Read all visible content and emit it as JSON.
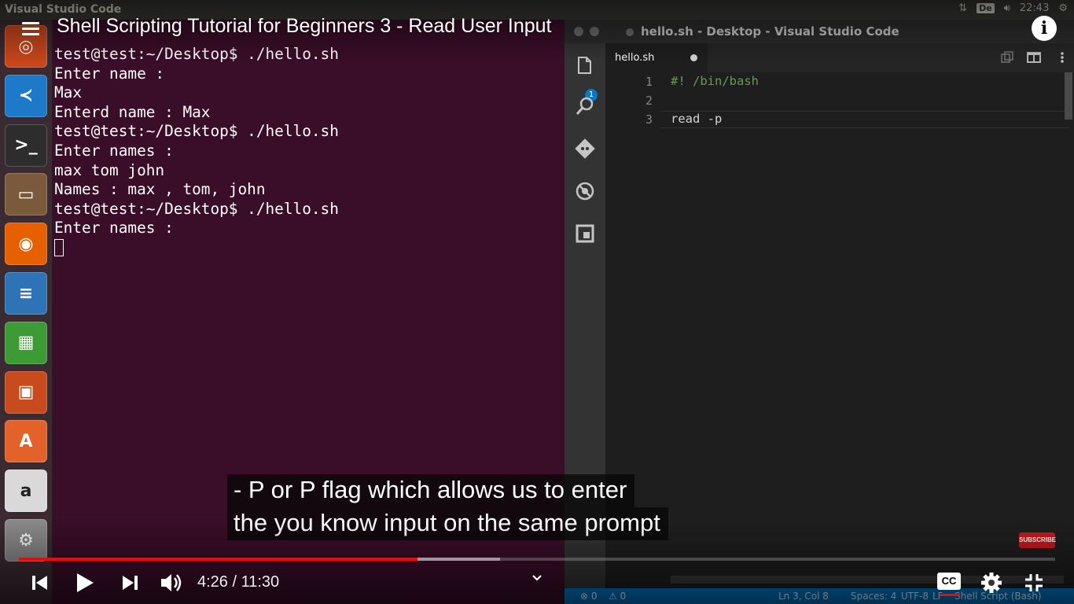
{
  "topbar": {
    "app_title": "Visual Studio Code",
    "keyboard_layout": "De",
    "clock": "22:43"
  },
  "launcher": {
    "items": [
      {
        "name": "ubuntu-dash",
        "glyph": "◎",
        "color": "#c8461b"
      },
      {
        "name": "vscode",
        "glyph": "≺",
        "color": "#1e79c9"
      },
      {
        "name": "terminal",
        "glyph": ">_",
        "color": "#2d2d2d"
      },
      {
        "name": "files",
        "glyph": "▭",
        "color": "#7a5a3a"
      },
      {
        "name": "firefox",
        "glyph": "◉",
        "color": "#e66000"
      },
      {
        "name": "writer",
        "glyph": "≡",
        "color": "#2f73b7"
      },
      {
        "name": "calc",
        "glyph": "▦",
        "color": "#3d9b35"
      },
      {
        "name": "impress",
        "glyph": "▣",
        "color": "#c84b1e"
      },
      {
        "name": "software-center",
        "glyph": "A",
        "color": "#e2622a"
      },
      {
        "name": "amazon",
        "glyph": "a",
        "color": "#d9d9d9"
      },
      {
        "name": "system-settings",
        "glyph": "⚙",
        "color": "#8a8a8a"
      }
    ]
  },
  "terminal": {
    "lines": [
      "test@test:~/Desktop$ ./hello.sh",
      "Enter name :",
      "Max",
      "Enterd name : Max",
      "test@test:~/Desktop$ ./hello.sh",
      "Enter names :",
      "max tom john",
      "Names : max , tom, john",
      "test@test:~/Desktop$ ./hello.sh",
      "Enter names :"
    ]
  },
  "vscode": {
    "window_title": "hello.sh - Desktop - Visual Studio Code",
    "explorer_badge": "1",
    "tab_label": "hello.sh",
    "lines": [
      {
        "number": "1",
        "text": "#! /bin/bash",
        "color": "#6a9955"
      },
      {
        "number": "2",
        "text": "",
        "color": "#d4d4d4"
      },
      {
        "number": "3",
        "text": "read -p",
        "color": "#d4d4d4"
      }
    ],
    "status": {
      "errors": "⊗ 0",
      "warnings": "⚠ 0",
      "position": "Ln 3, Col 8",
      "spaces": "Spaces: 4",
      "encoding": "UTF-8",
      "eol": "LF",
      "language": "Shell Script (Bash)"
    }
  },
  "video": {
    "title": "Shell Scripting Tutorial for Beginners 3 - Read User Input",
    "captions": [
      "- P or P flag which allows us to enter",
      "the you know input on the same prompt"
    ],
    "subscribe_label": "SUBSCRIBE",
    "current_time": "4:26",
    "duration": "11:30",
    "time_display": "4:26 / 11:30",
    "played_fraction": 0.385,
    "buffered_fraction": 0.464,
    "cc_label": "CC"
  },
  "colors": {
    "terminal_bg": "#3a0d28",
    "vscode_bg": "#1e1e1e",
    "status_bar": "#007acc",
    "progress_red": "#ff0000"
  }
}
